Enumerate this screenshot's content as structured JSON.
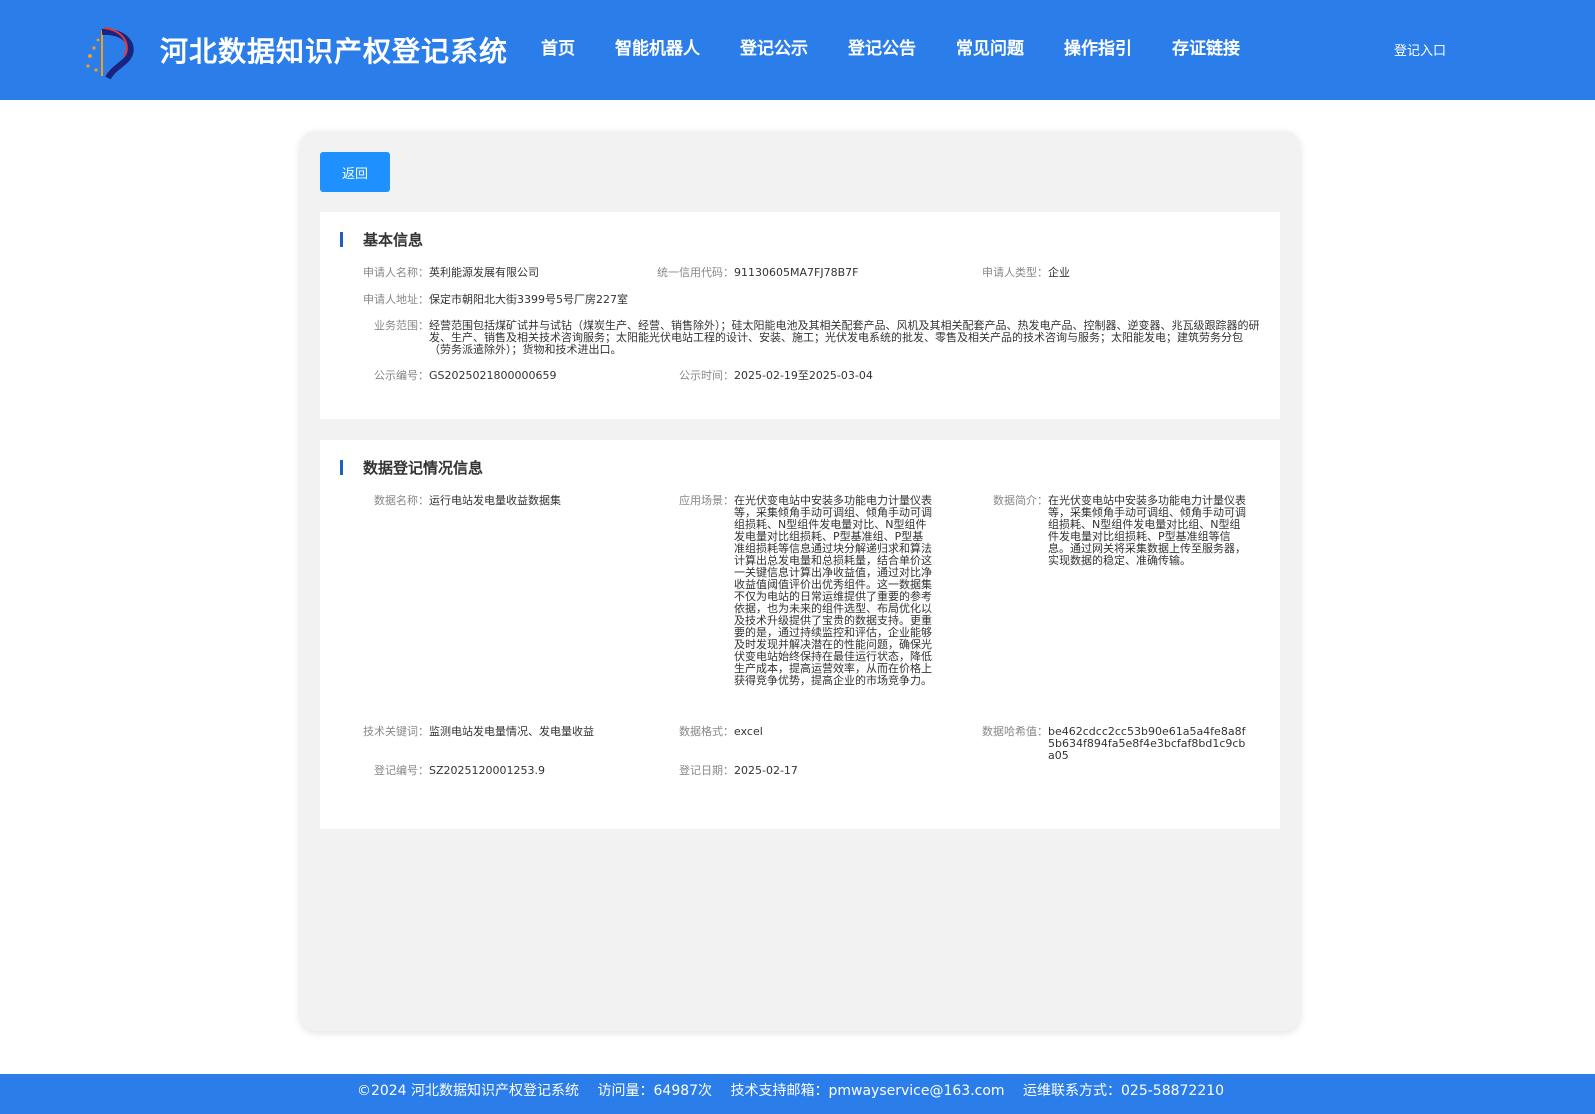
{
  "header": {
    "site_title": "河北数据知识产权登记系统",
    "nav": [
      "首页",
      "智能机器人",
      "登记公示",
      "登记公告",
      "常见问题",
      "操作指引",
      "存证链接"
    ],
    "login": "登记入口"
  },
  "toolbar": {
    "back": "返回"
  },
  "basic": {
    "title": "基本信息",
    "applicant_name_label": "申请人名称：",
    "applicant_name": "英利能源发展有限公司",
    "credit_code_label": "统一信用代码：",
    "credit_code": "91130605MA7FJ78B7F",
    "applicant_type_label": "申请人类型：",
    "applicant_type": "企业",
    "address_label": "申请人地址：",
    "address": "保定市朝阳北大街3399号5号厂房227室",
    "scope_label": "业务范围：",
    "scope": "经营范围包括煤矿试井与试钻（煤炭生产、经营、销售除外）；硅太阳能电池及其相关配套产品、风机及其相关配套产品、热发电产品、控制器、逆变器、兆瓦级跟踪器的研发、生产、销售及相关技术咨询服务；太阳能光伏电站工程的设计、安装、施工；光伏发电系统的批发、零售及相关产品的技术咨询与服务；太阳能发电；建筑劳务分包（劳务派遣除外）；货物和技术进出口。",
    "notice_no_label": "公示编号：",
    "notice_no": "GS2025021800000659",
    "notice_time_label": "公示时间：",
    "notice_time": "2025-02-19至2025-03-04"
  },
  "data_info": {
    "title": "数据登记情况信息",
    "data_name_label": "数据名称：",
    "data_name": "运行电站发电量收益数据集",
    "scenario_label": "应用场景：",
    "scenario": "在光伏变电站中安装多功能电力计量仪表等，采集倾角手动可调组、倾角手动可调组损耗、N型组件发电量对比、N型组件发电量对比组损耗、P型基准组、P型基准组损耗等信息通过块分解递归求和算法计算出总发电量和总损耗量，结合单价这一关键信息计算出净收益值，通过对比净收益值阈值评价出优秀组件。这一数据集不仅为电站的日常运维提供了重要的参考依据，也为未来的组件选型、布局优化以及技术升级提供了宝贵的数据支持。更重要的是，通过持续监控和评估，企业能够及时发现并解决潜在的性能问题，确保光伏变电站始终保持在最佳运行状态，降低生产成本，提高运营效率，从而在价格上获得竞争优势，提高企业的市场竞争力。",
    "summary_label": "数据简介：",
    "summary": "在光伏变电站中安装多功能电力计量仪表等，采集倾角手动可调组、倾角手动可调组损耗、N型组件发电量对比组、N型组件发电量对比组损耗、P型基准组等信息。通过网关将采集数据上传至服务器，实现数据的稳定、准确传输。",
    "keywords_label": "技术关键词：",
    "keywords": "监测电站发电量情况、发电量收益",
    "format_label": "数据格式：",
    "format": "excel",
    "hash_label": "数据哈希值：",
    "hash": "be462cdcc2cc53b90e61a5a4fe8a8f5b634f894fa5e8f4e3bcfaf8bd1c9cba05",
    "reg_no_label": "登记编号：",
    "reg_no": "SZ2025120001253.9",
    "reg_date_label": "登记日期：",
    "reg_date": "2025-02-17"
  },
  "footer": {
    "copyright": "©2024 河北数据知识产权登记系统",
    "visits": "访问量：64987次",
    "email": "技术支持邮箱：pmwayservice@163.com",
    "contact": "运维联系方式：025-58872210"
  }
}
